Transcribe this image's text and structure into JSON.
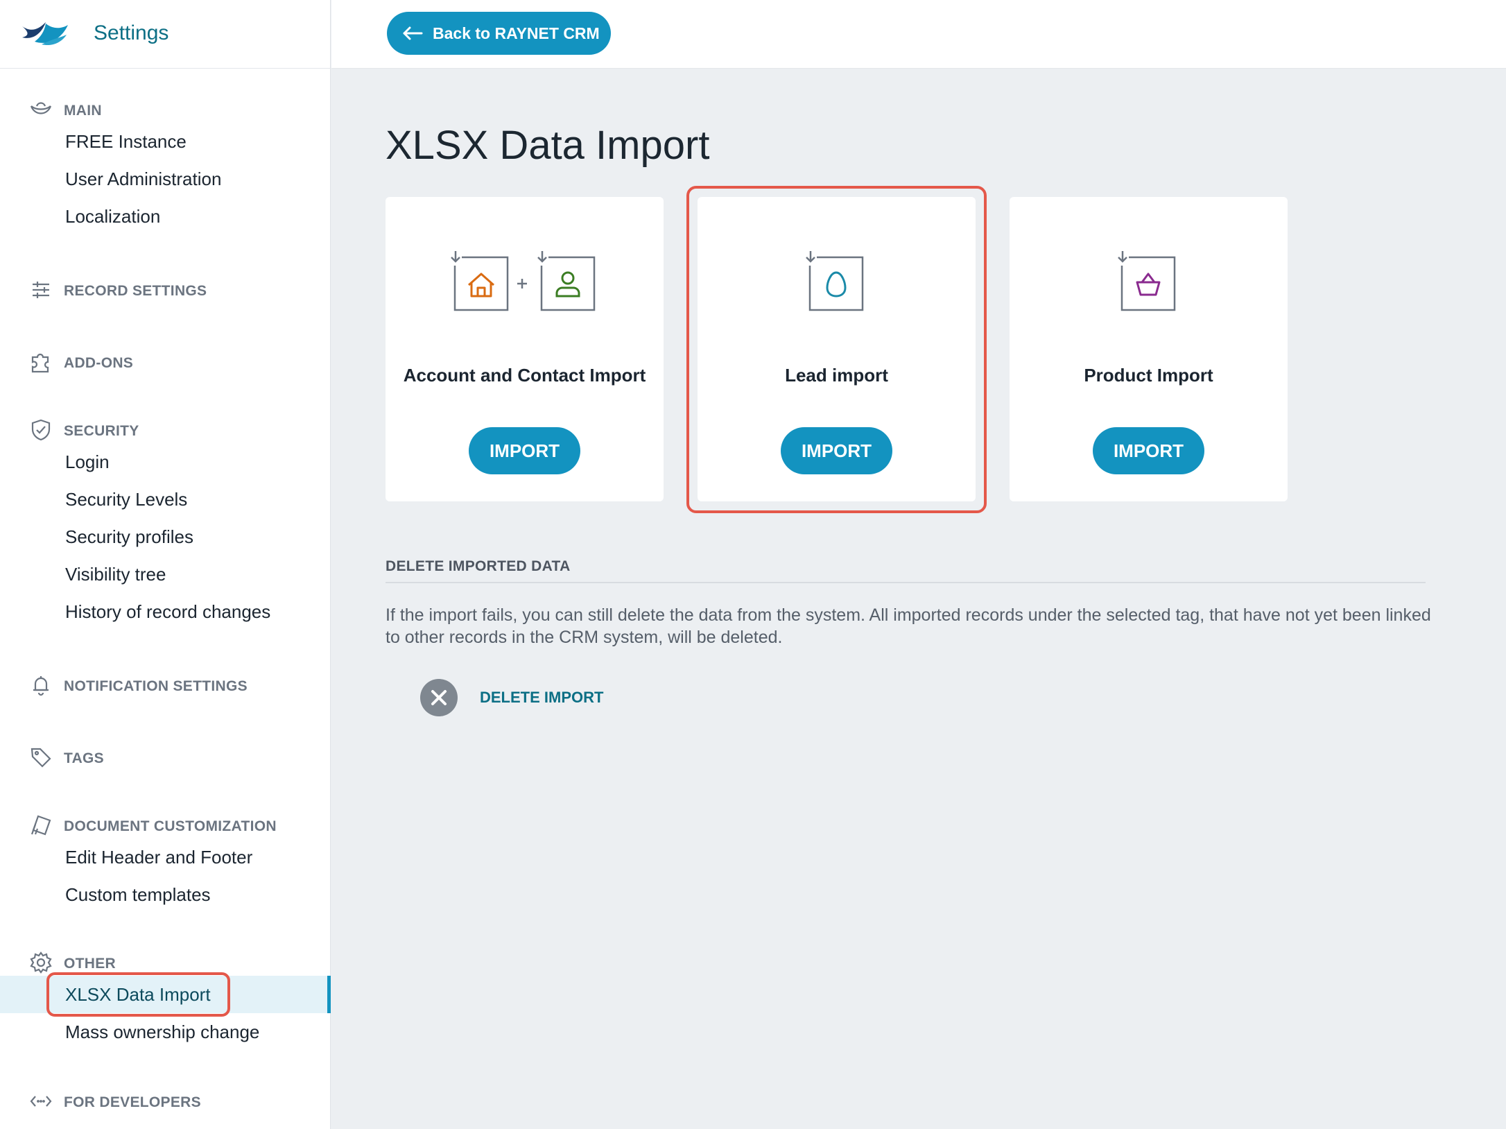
{
  "app": {
    "title": "Settings"
  },
  "topbar": {
    "back_label": "Back to RAYNET CRM"
  },
  "sidebar": {
    "sections": [
      {
        "icon": "hat-icon",
        "label": "MAIN",
        "items": [
          "FREE Instance",
          "User Administration",
          "Localization"
        ]
      },
      {
        "icon": "sliders-icon",
        "label": "RECORD SETTINGS",
        "items": []
      },
      {
        "icon": "puzzle-icon",
        "label": "ADD-ONS",
        "items": []
      },
      {
        "icon": "shield-icon",
        "label": "SECURITY",
        "items": [
          "Login",
          "Security Levels",
          "Security profiles",
          "Visibility tree",
          "History of record changes"
        ]
      },
      {
        "icon": "bell-icon",
        "label": "NOTIFICATION SETTINGS",
        "items": []
      },
      {
        "icon": "tag-icon",
        "label": "TAGS",
        "items": []
      },
      {
        "icon": "document-icon",
        "label": "DOCUMENT CUSTOMIZATION",
        "items": [
          "Edit Header and Footer",
          "Custom templates"
        ]
      },
      {
        "icon": "gear-icon",
        "label": "OTHER",
        "items": [
          "XLSX Data Import",
          "Mass ownership change"
        ],
        "active_item": "XLSX Data Import"
      },
      {
        "icon": "code-icon",
        "label": "FOR DEVELOPERS",
        "items": []
      }
    ]
  },
  "main": {
    "title": "XLSX Data Import",
    "cards": [
      {
        "title": "Account and Contact Import",
        "button": "IMPORT",
        "icons": [
          "house-icon",
          "person-icon"
        ]
      },
      {
        "title": "Lead import",
        "button": "IMPORT",
        "icons": [
          "egg-icon"
        ]
      },
      {
        "title": "Product Import",
        "button": "IMPORT",
        "icons": [
          "basket-icon"
        ]
      }
    ],
    "delete_section": {
      "heading": "DELETE IMPORTED DATA",
      "text": "If the import fails, you can still delete the data from the system. All imported records under the selected tag, that have not yet been linked to other records in the CRM system, will be deleted.",
      "button": "DELETE IMPORT"
    }
  },
  "colors": {
    "accent": "#1393c0",
    "highlight": "#e4584a",
    "house": "#d96b12",
    "person": "#3b7d23",
    "egg": "#1a8aa8",
    "basket": "#8a2b8f"
  }
}
